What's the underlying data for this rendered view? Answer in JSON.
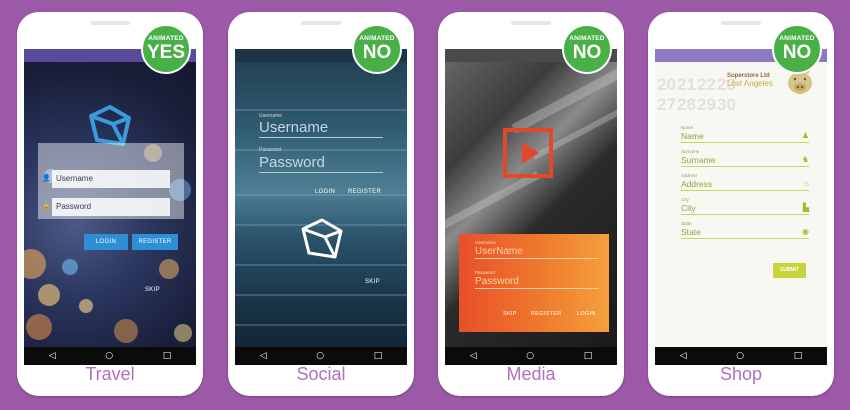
{
  "phones": [
    {
      "label": "Travel",
      "badge": {
        "small": "ANIMATED",
        "big": "YES"
      },
      "username_placeholder": "Username",
      "password_placeholder": "Password",
      "login_label": "LOGIN",
      "register_label": "REGISTER",
      "skip_label": "SKIP"
    },
    {
      "label": "Social",
      "badge": {
        "small": "ANIMATED",
        "big": "NO"
      },
      "username_caption": "Username",
      "username_placeholder": "Username",
      "password_caption": "Password",
      "password_placeholder": "Password",
      "login_label": "LOGIN",
      "register_label": "REGISTER",
      "skip_label": "SKIP"
    },
    {
      "label": "Media",
      "badge": {
        "small": "ANIMATED",
        "big": "NO"
      },
      "username_caption": "Username",
      "username_placeholder": "UserName",
      "password_caption": "Password",
      "password_placeholder": "Password",
      "skip_label": "SKIP",
      "register_label": "REGISTER",
      "login_label": "LOGIN"
    },
    {
      "label": "Shop",
      "badge": {
        "small": "ANIMATED",
        "big": "NO"
      },
      "brand": "Superstore Ltd",
      "city": "Lost Angeles",
      "calendar_numbers": [
        "20",
        "21",
        "22",
        "23",
        "27",
        "28",
        "29",
        "30"
      ],
      "fields": [
        {
          "caption": "Name",
          "value": "Name",
          "icon": "person-icon"
        },
        {
          "caption": "Surname",
          "value": "Surname",
          "icon": "people-icon"
        },
        {
          "caption": "Address",
          "value": "Address",
          "icon": "home-icon"
        },
        {
          "caption": "City",
          "value": "City",
          "icon": "building-icon"
        },
        {
          "caption": "State",
          "value": "State",
          "icon": "globe-icon"
        }
      ],
      "submit_label": "SUBMIT"
    }
  ],
  "nav_glyphs": {
    "back": "◁",
    "home": "○",
    "recent": "□"
  },
  "colors": {
    "background": "#9b59a7",
    "label": "#b06fc0",
    "badge": "#49b048",
    "travel_button": "#2f8fd6",
    "media_accent": "#e2492c",
    "shop_accent": "#c7d43a"
  }
}
